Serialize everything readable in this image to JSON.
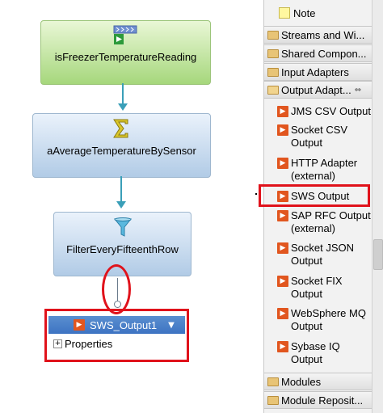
{
  "diagram": {
    "nodes": [
      {
        "id": "n1",
        "label": "isFreezerTemperatureReading",
        "icon": "stream-input-icon"
      },
      {
        "id": "n2",
        "label": "aAverageTemperatureBySensor",
        "icon": "sigma-icon"
      },
      {
        "id": "n3",
        "label": "FilterEveryFifteenthRow",
        "icon": "funnel-icon"
      }
    ],
    "output_node": {
      "label": "SWS_Output1",
      "properties_label": "Properties",
      "icon": "output-adapter-icon"
    }
  },
  "palette": {
    "note_label": "Note",
    "drawers": [
      {
        "label": "Streams and Wi..."
      },
      {
        "label": "Shared Compon..."
      },
      {
        "label": "Input Adapters"
      },
      {
        "label": "Output Adapt..."
      }
    ],
    "output_items": [
      "JMS CSV Output",
      "Socket CSV Output",
      "HTTP Adapter (external)",
      "SWS Output",
      "SAP RFC Output (external)",
      "Socket JSON Output",
      "Socket FIX Output",
      "WebSphere MQ Output",
      "Sybase IQ Output"
    ],
    "bottom_drawers": [
      {
        "label": "Modules"
      },
      {
        "label": "Module Reposit..."
      }
    ]
  },
  "colors": {
    "highlight": "#e0121b",
    "connector": "#3a9fb8",
    "adapter_icon": "#e1561f",
    "output_header": "#3d73c2"
  }
}
